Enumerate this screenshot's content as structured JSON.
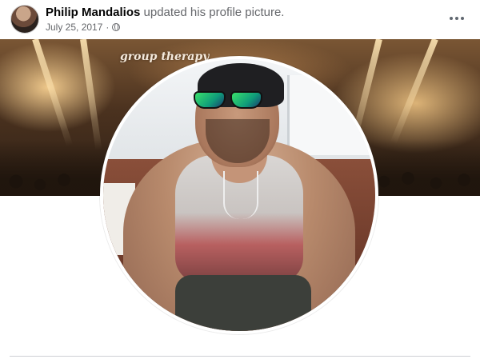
{
  "post": {
    "author": "Philip Mandalios",
    "action": "updated his profile picture.",
    "date": "July 25, 2017",
    "separator": "·",
    "privacy_icon": "globe-icon",
    "menu_icon": "more-horizontal-icon"
  },
  "cover": {
    "overlay_text": "group therapy"
  },
  "colors": {
    "author_text": "#050505",
    "secondary_text": "#65676b",
    "divider": "#ced0d4",
    "background": "#ffffff"
  }
}
